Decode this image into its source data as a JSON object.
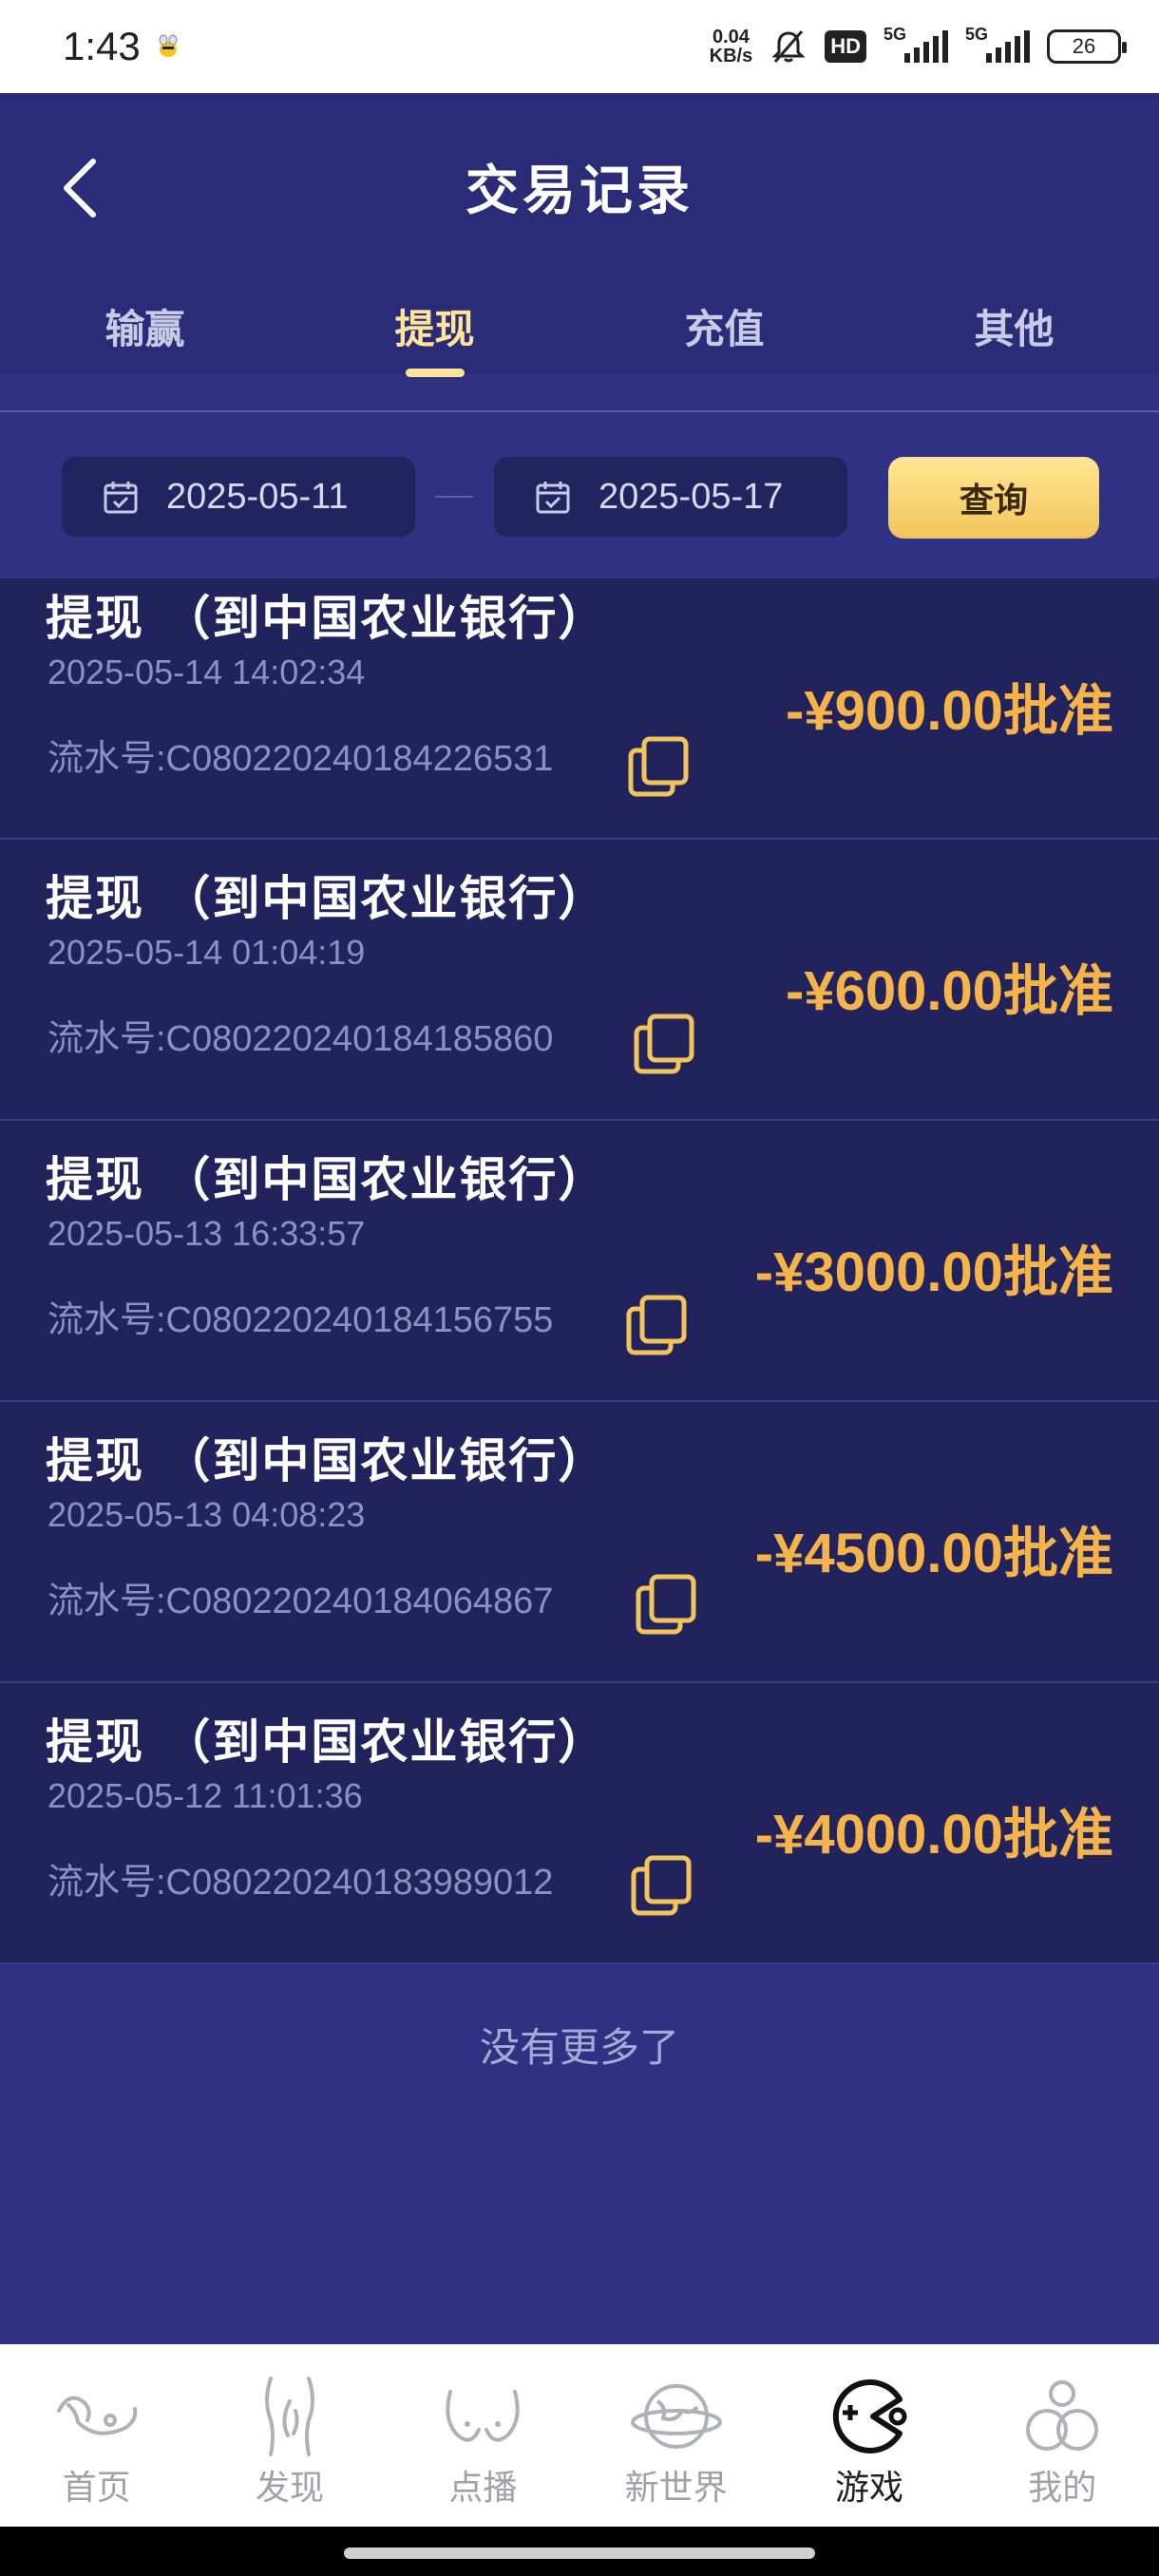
{
  "status_bar": {
    "time": "1:43",
    "net_speed_value": "0.04",
    "net_speed_unit": "KB/s",
    "hd_label": "HD",
    "sim1_label": "5G",
    "sim2_label": "5G",
    "battery": "26"
  },
  "header": {
    "title": "交易记录",
    "tabs": [
      {
        "label": "输赢",
        "active": false
      },
      {
        "label": "提现",
        "active": true
      },
      {
        "label": "充值",
        "active": false
      },
      {
        "label": "其他",
        "active": false
      }
    ]
  },
  "filter": {
    "start_date": "2025-05-11",
    "end_date": "2025-05-17",
    "query_label": "查询"
  },
  "records": [
    {
      "title": "提现 （到中国农业银行）",
      "datetime": "2025-05-14 14:02:34",
      "serial": "流水号:C080220240184226531",
      "amount": "-¥900.00批准"
    },
    {
      "title": "提现 （到中国农业银行）",
      "datetime": "2025-05-14 01:04:19",
      "serial": "流水号:C080220240184185860",
      "amount": "-¥600.00批准"
    },
    {
      "title": "提现 （到中国农业银行）",
      "datetime": "2025-05-13 16:33:57",
      "serial": "流水号:C080220240184156755",
      "amount": "-¥3000.00批准"
    },
    {
      "title": "提现 （到中国农业银行）",
      "datetime": "2025-05-13 04:08:23",
      "serial": "流水号:C080220240184064867",
      "amount": "-¥4500.00批准"
    },
    {
      "title": "提现 （到中国农业银行）",
      "datetime": "2025-05-12 11:01:36",
      "serial": "流水号:C080220240183989012",
      "amount": "-¥4000.00批准"
    }
  ],
  "end_text": "没有更多了",
  "bottom_nav": [
    {
      "label": "首页",
      "icon": "home-icon",
      "active": false
    },
    {
      "label": "发现",
      "icon": "discover-icon",
      "active": false
    },
    {
      "label": "点播",
      "icon": "vod-icon",
      "active": false
    },
    {
      "label": "新世界",
      "icon": "new-world-icon",
      "active": false
    },
    {
      "label": "游戏",
      "icon": "game-icon",
      "active": true
    },
    {
      "label": "我的",
      "icon": "profile-icon",
      "active": false
    }
  ],
  "colors": {
    "background": "#2f3182",
    "header": "#2a2c78",
    "row": "#22235c",
    "accent_tab": "#ffe49a",
    "amount": "#f5b44a",
    "query_button": "#f2c45c"
  }
}
